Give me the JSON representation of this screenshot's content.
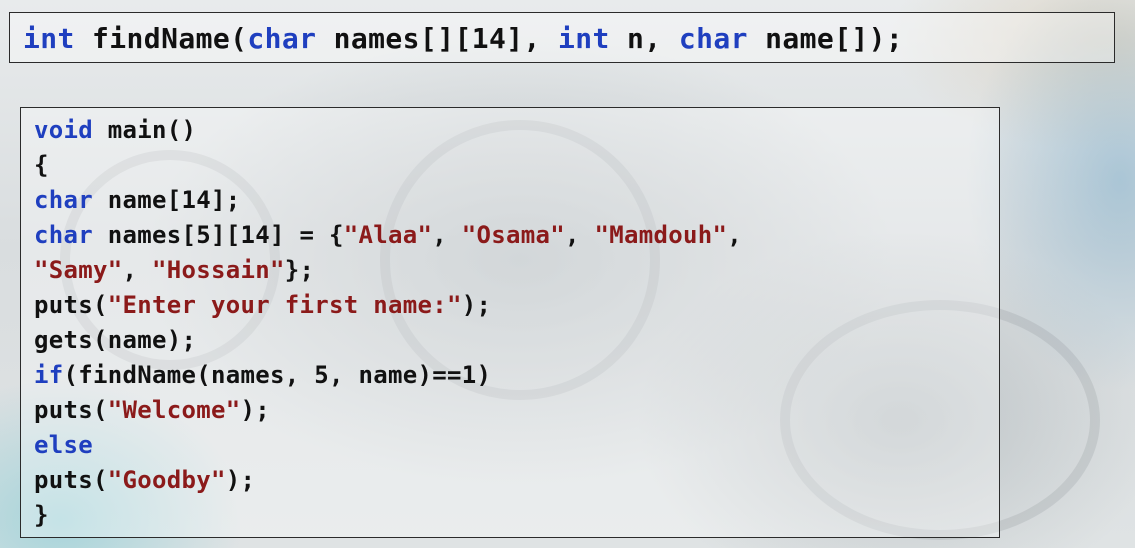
{
  "prototype": [
    {
      "t": "int",
      "c": "kw"
    },
    {
      "t": " findName(",
      "c": "pl"
    },
    {
      "t": "char",
      "c": "kw"
    },
    {
      "t": " names[][14], ",
      "c": "pl"
    },
    {
      "t": "int",
      "c": "kw"
    },
    {
      "t": " n, ",
      "c": "pl"
    },
    {
      "t": "char",
      "c": "kw"
    },
    {
      "t": " name[]);",
      "c": "pl"
    }
  ],
  "code": [
    [
      {
        "t": "void",
        "c": "kw"
      },
      {
        "t": " main()",
        "c": "pl"
      }
    ],
    [
      {
        "t": "{",
        "c": "pl"
      }
    ],
    [
      {
        "t": "char",
        "c": "kw"
      },
      {
        "t": " name[14];",
        "c": "pl"
      }
    ],
    [
      {
        "t": "char",
        "c": "kw"
      },
      {
        "t": " names[5][14] = {",
        "c": "pl"
      },
      {
        "t": "\"Alaa\"",
        "c": "str"
      },
      {
        "t": ", ",
        "c": "pl"
      },
      {
        "t": "\"Osama\"",
        "c": "str"
      },
      {
        "t": ", ",
        "c": "pl"
      },
      {
        "t": "\"Mamdouh\"",
        "c": "str"
      },
      {
        "t": ",",
        "c": "pl"
      }
    ],
    [
      {
        "t": "\"Samy\"",
        "c": "str"
      },
      {
        "t": ", ",
        "c": "pl"
      },
      {
        "t": "\"Hossain\"",
        "c": "str"
      },
      {
        "t": "};",
        "c": "pl"
      }
    ],
    [
      {
        "t": "puts(",
        "c": "pl"
      },
      {
        "t": "\"Enter your first name:\"",
        "c": "str"
      },
      {
        "t": ");",
        "c": "pl"
      }
    ],
    [
      {
        "t": "gets(name);",
        "c": "pl"
      }
    ],
    [
      {
        "t": "if",
        "c": "kw"
      },
      {
        "t": "(findName(names, 5, name)==1)",
        "c": "pl"
      }
    ],
    [
      {
        "t": "puts(",
        "c": "pl"
      },
      {
        "t": "\"Welcome\"",
        "c": "str"
      },
      {
        "t": ");",
        "c": "pl"
      }
    ],
    [
      {
        "t": "else",
        "c": "kw"
      }
    ],
    [
      {
        "t": "puts(",
        "c": "pl"
      },
      {
        "t": "\"Goodby\"",
        "c": "str"
      },
      {
        "t": ");",
        "c": "pl"
      }
    ],
    [
      {
        "t": "}",
        "c": "pl"
      }
    ]
  ],
  "colors": {
    "keyword": "#1f3fbf",
    "string": "#8b1a1a",
    "plain": "#111111"
  }
}
